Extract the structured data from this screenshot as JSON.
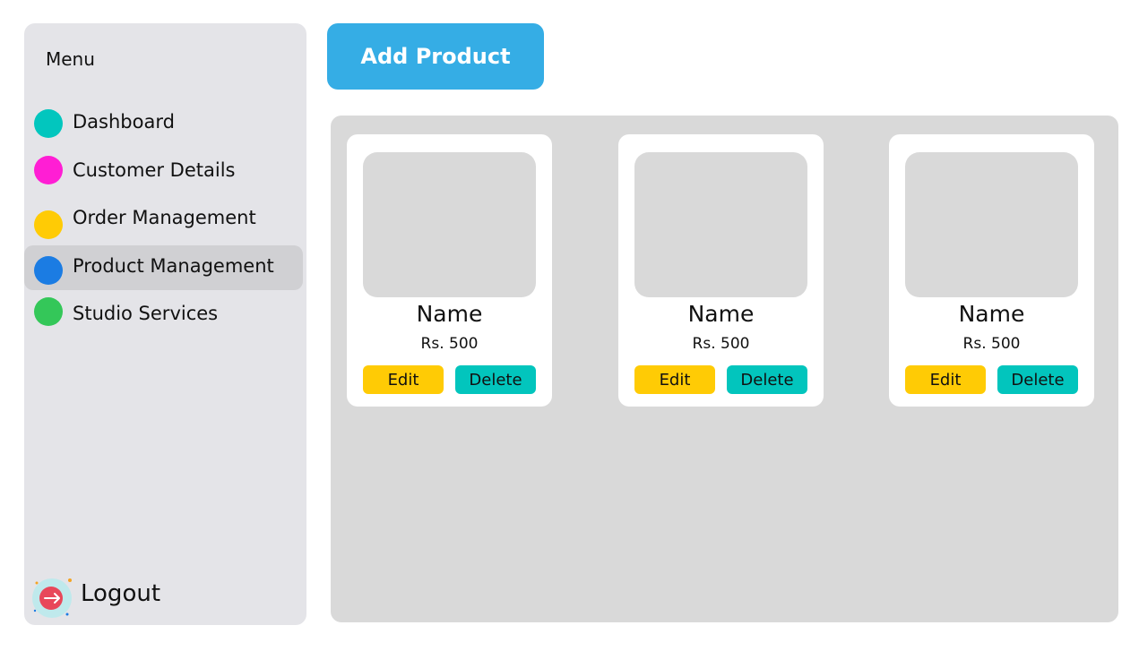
{
  "sidebar": {
    "title": "Menu",
    "items": [
      {
        "label": "Dashboard",
        "dot_color": "#02c6be",
        "active": false
      },
      {
        "label": "Customer Details",
        "dot_color": "#ff1ed4",
        "active": false
      },
      {
        "label": "Order Management",
        "dot_color": "#ffcb05",
        "active": false
      },
      {
        "label": "Product Management",
        "dot_color": "#1b7ce3",
        "active": true
      },
      {
        "label": "Studio Services",
        "dot_color": "#34c759",
        "active": false
      }
    ],
    "logout_label": "Logout",
    "logout_icon": "logout-icon"
  },
  "toolbar": {
    "add_label": "Add Product",
    "add_color": "#35ade5"
  },
  "products": [
    {
      "name": "Name",
      "price": "Rs. 500",
      "edit_label": "Edit",
      "delete_label": "Delete"
    },
    {
      "name": "Name",
      "price": "Rs. 500",
      "edit_label": "Edit",
      "delete_label": "Delete"
    },
    {
      "name": "Name",
      "price": "Rs. 500",
      "edit_label": "Edit",
      "delete_label": "Delete"
    }
  ],
  "colors": {
    "edit": "#ffcb05",
    "delete": "#02c5bd"
  }
}
